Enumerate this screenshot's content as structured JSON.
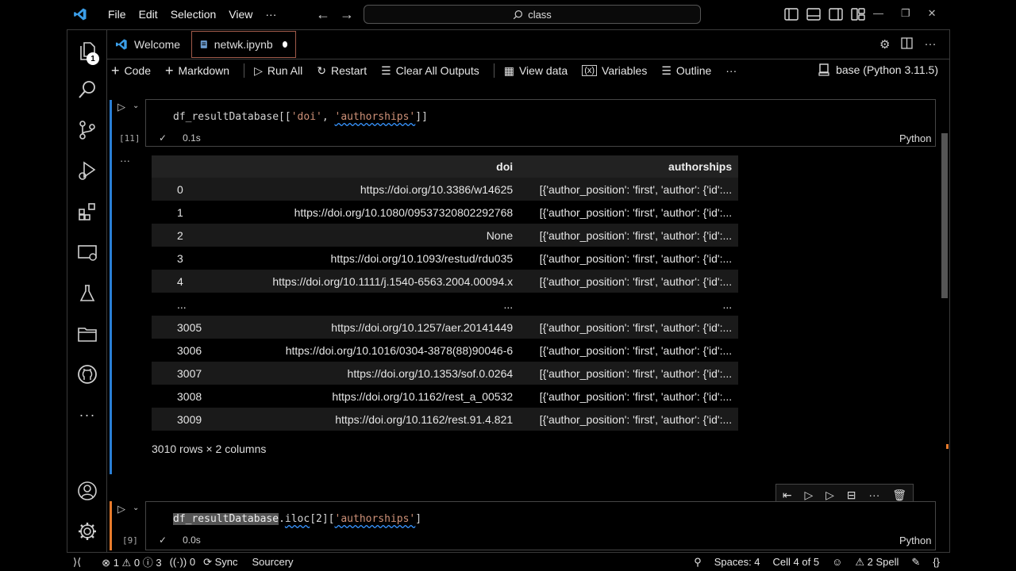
{
  "menu": [
    "File",
    "Edit",
    "Selection",
    "View",
    "···"
  ],
  "search": {
    "text": "class"
  },
  "tabs": [
    {
      "label": "Welcome"
    },
    {
      "label": "netwk.ipynb"
    }
  ],
  "activity_badge": "1",
  "toolbar": {
    "code": "Code",
    "markdown": "Markdown",
    "run_all": "Run All",
    "restart": "Restart",
    "clear": "Clear All Outputs",
    "view_data": "View data",
    "variables": "Variables",
    "outline": "Outline",
    "more": "···",
    "kernel": "base (Python 3.11.5)"
  },
  "cell1": {
    "exec_count": "[11]",
    "time": "0.1s",
    "lang": "Python",
    "code_prefix": "df_resultDatabase[[",
    "code_doi": "'doi'",
    "code_sep": ", ",
    "code_auth": "'authorships'",
    "code_suffix": "]]"
  },
  "output": {
    "ellipsis": "···",
    "columns": [
      "doi",
      "authorships"
    ],
    "rows": [
      [
        "0",
        "https://doi.org/10.3386/w14625",
        "[{'author_position': 'first', 'author': {'id':..."
      ],
      [
        "1",
        "https://doi.org/10.1080/09537320802292768",
        "[{'author_position': 'first', 'author': {'id':..."
      ],
      [
        "2",
        "None",
        "[{'author_position': 'first', 'author': {'id':..."
      ],
      [
        "3",
        "https://doi.org/10.1093/restud/rdu035",
        "[{'author_position': 'first', 'author': {'id':..."
      ],
      [
        "4",
        "https://doi.org/10.1111/j.1540-6563.2004.00094.x",
        "[{'author_position': 'first', 'author': {'id':..."
      ],
      [
        "...",
        "...",
        "..."
      ],
      [
        "3005",
        "https://doi.org/10.1257/aer.20141449",
        "[{'author_position': 'first', 'author': {'id':..."
      ],
      [
        "3006",
        "https://doi.org/10.1016/0304-3878(88)90046-6",
        "[{'author_position': 'first', 'author': {'id':..."
      ],
      [
        "3007",
        "https://doi.org/10.1353/sof.0.0264",
        "[{'author_position': 'first', 'author': {'id':..."
      ],
      [
        "3008",
        "https://doi.org/10.1162/rest_a_00532",
        "[{'author_position': 'first', 'author': {'id':..."
      ],
      [
        "3009",
        "https://doi.org/10.1162/rest.91.4.821",
        "[{'author_position': 'first', 'author': {'id':..."
      ]
    ],
    "shape": "3010 rows × 2 columns"
  },
  "cell2": {
    "exec_count": "[9]",
    "time": "0.0s",
    "lang": "Python",
    "code_var": "df_resultDatabase",
    "code_dot": ".",
    "code_iloc": "iloc",
    "code_idx": "[2][",
    "code_auth": "'authorships'",
    "code_end": "]"
  },
  "statusbar": {
    "errors": "1",
    "warnings": "0",
    "info": "3",
    "ports": "0",
    "sync": "Sync",
    "sourcery": "Sourcery",
    "spaces": "Spaces: 4",
    "cell": "Cell 4 of 5",
    "spell": "2 Spell"
  },
  "colors": {
    "accent_bar": "#e87b2c",
    "blue_bar": "#2a7fd6",
    "string": "#ce9178"
  }
}
